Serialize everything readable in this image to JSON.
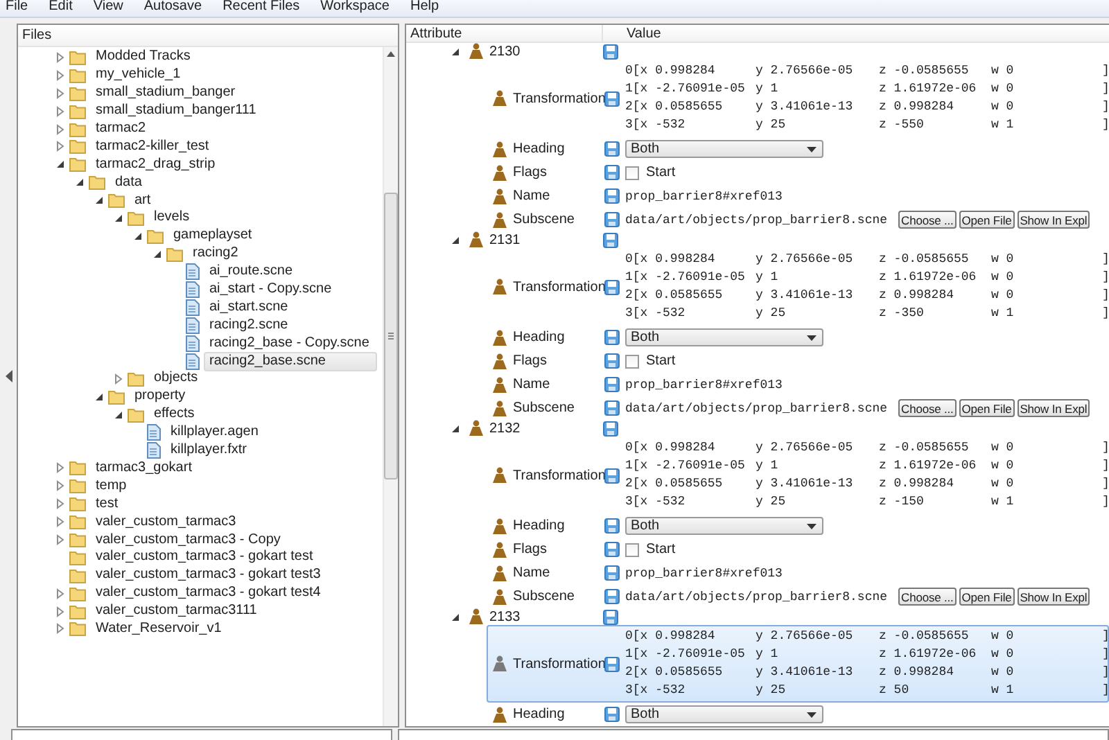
{
  "menu": [
    "File",
    "Edit",
    "View",
    "Autosave",
    "Recent Files",
    "Workspace",
    "Help"
  ],
  "files_panel": {
    "title": "Files",
    "tree": [
      {
        "name": "Modded Tracks",
        "kind": "folder",
        "expanded": false,
        "selected": false
      },
      {
        "name": "my_vehicle_1",
        "kind": "folder",
        "expanded": false,
        "selected": false
      },
      {
        "name": "small_stadium_banger",
        "kind": "folder",
        "expanded": false,
        "selected": false
      },
      {
        "name": "small_stadium_banger111",
        "kind": "folder",
        "expanded": false,
        "selected": false
      },
      {
        "name": "tarmac2",
        "kind": "folder",
        "expanded": false,
        "selected": false
      },
      {
        "name": "tarmac2-killer_test",
        "kind": "folder",
        "expanded": false,
        "selected": false
      },
      {
        "name": "tarmac2_drag_strip",
        "kind": "folder",
        "expanded": true,
        "selected": false,
        "children": [
          {
            "name": "data",
            "kind": "folder",
            "expanded": true,
            "selected": false,
            "children": [
              {
                "name": "art",
                "kind": "folder",
                "expanded": true,
                "selected": false,
                "children": [
                  {
                    "name": "levels",
                    "kind": "folder",
                    "expanded": true,
                    "selected": false,
                    "children": [
                      {
                        "name": "gameplayset",
                        "kind": "folder",
                        "expanded": true,
                        "selected": false,
                        "children": [
                          {
                            "name": "racing2",
                            "kind": "folder",
                            "expanded": true,
                            "selected": false,
                            "children": [
                              {
                                "name": "ai_route.scne",
                                "kind": "file",
                                "selected": false
                              },
                              {
                                "name": "ai_start - Copy.scne",
                                "kind": "file",
                                "selected": false
                              },
                              {
                                "name": "ai_start.scne",
                                "kind": "file",
                                "selected": false
                              },
                              {
                                "name": "racing2.scne",
                                "kind": "file",
                                "selected": false
                              },
                              {
                                "name": "racing2_base - Copy.scne",
                                "kind": "file",
                                "selected": false
                              },
                              {
                                "name": "racing2_base.scne",
                                "kind": "file",
                                "selected": true
                              }
                            ]
                          }
                        ]
                      }
                    ]
                  },
                  {
                    "name": "objects",
                    "kind": "folder",
                    "expanded": false,
                    "selected": false
                  }
                ]
              },
              {
                "name": "property",
                "kind": "folder",
                "expanded": true,
                "selected": false,
                "children": [
                  {
                    "name": "effects",
                    "kind": "folder",
                    "expanded": true,
                    "selected": false,
                    "children": [
                      {
                        "name": "killplayer.agen",
                        "kind": "file",
                        "selected": false
                      },
                      {
                        "name": "killplayer.fxtr",
                        "kind": "file",
                        "selected": false
                      }
                    ]
                  }
                ]
              }
            ]
          }
        ]
      },
      {
        "name": "tarmac3_gokart",
        "kind": "folder",
        "expanded": false,
        "selected": false
      },
      {
        "name": "temp",
        "kind": "folder",
        "expanded": false,
        "selected": false
      },
      {
        "name": "test",
        "kind": "folder",
        "expanded": false,
        "selected": false
      },
      {
        "name": "valer_custom_tarmac3",
        "kind": "folder",
        "expanded": false,
        "selected": false
      },
      {
        "name": "valer_custom_tarmac3 - Copy",
        "kind": "folder",
        "expanded": false,
        "selected": false
      },
      {
        "name": "valer_custom_tarmac3 - gokart test",
        "kind": "folder",
        "selected": false
      },
      {
        "name": "valer_custom_tarmac3 - gokart test3",
        "kind": "folder",
        "selected": false
      },
      {
        "name": "valer_custom_tarmac3 - gokart test4",
        "kind": "folder",
        "expanded": false,
        "selected": false
      },
      {
        "name": "valer_custom_tarmac3111",
        "kind": "folder",
        "expanded": false,
        "selected": false
      },
      {
        "name": "Water_Reservoir_v1",
        "kind": "folder",
        "expanded": false,
        "selected": false
      }
    ]
  },
  "attributes": {
    "columns": [
      "Attribute",
      "Value"
    ],
    "groups": [
      {
        "id": "2130",
        "expanded": true,
        "rows": [
          {
            "kind": "matrix",
            "label": "Transformation",
            "selected": false,
            "lines": [
              [
                "0[x 0.998284",
                "y 2.76566e-05",
                "z -0.0585655",
                "w 0",
                "]"
              ],
              [
                "1[x -2.76091e-05",
                "y 1",
                "z 1.61972e-06",
                "w 0",
                "]"
              ],
              [
                "2[x 0.0585655",
                "y 3.41061e-13",
                "z 0.998284",
                "w 0",
                "]"
              ],
              [
                "3[x -532",
                "y 25",
                "z -550",
                "w 1",
                "]"
              ]
            ]
          },
          {
            "kind": "dropdown",
            "label": "Heading",
            "selected": false,
            "value": "Both"
          },
          {
            "kind": "checkbox",
            "label": "Flags",
            "selected": false,
            "option": "Start",
            "checked": false
          },
          {
            "kind": "text",
            "label": "Name",
            "selected": false,
            "value": "prop_barrier8#xref013"
          },
          {
            "kind": "file",
            "label": "Subscene",
            "selected": false,
            "value": "data/art/objects/prop_barrier8.scne",
            "buttons": [
              "Choose ...",
              "Open File",
              "Show In Expl"
            ]
          }
        ]
      },
      {
        "id": "2131",
        "expanded": true,
        "rows": [
          {
            "kind": "matrix",
            "label": "Transformation",
            "selected": false,
            "lines": [
              [
                "0[x 0.998284",
                "y 2.76566e-05",
                "z -0.0585655",
                "w 0",
                "]"
              ],
              [
                "1[x -2.76091e-05",
                "y 1",
                "z 1.61972e-06",
                "w 0",
                "]"
              ],
              [
                "2[x 0.0585655",
                "y 3.41061e-13",
                "z 0.998284",
                "w 0",
                "]"
              ],
              [
                "3[x -532",
                "y 25",
                "z -350",
                "w 1",
                "]"
              ]
            ]
          },
          {
            "kind": "dropdown",
            "label": "Heading",
            "selected": false,
            "value": "Both"
          },
          {
            "kind": "checkbox",
            "label": "Flags",
            "selected": false,
            "option": "Start",
            "checked": false
          },
          {
            "kind": "text",
            "label": "Name",
            "selected": false,
            "value": "prop_barrier8#xref013"
          },
          {
            "kind": "file",
            "label": "Subscene",
            "selected": false,
            "value": "data/art/objects/prop_barrier8.scne",
            "buttons": [
              "Choose ...",
              "Open File",
              "Show In Expl"
            ]
          }
        ]
      },
      {
        "id": "2132",
        "expanded": true,
        "rows": [
          {
            "kind": "matrix",
            "label": "Transformation",
            "selected": false,
            "lines": [
              [
                "0[x 0.998284",
                "y 2.76566e-05",
                "z -0.0585655",
                "w 0",
                "]"
              ],
              [
                "1[x -2.76091e-05",
                "y 1",
                "z 1.61972e-06",
                "w 0",
                "]"
              ],
              [
                "2[x 0.0585655",
                "y 3.41061e-13",
                "z 0.998284",
                "w 0",
                "]"
              ],
              [
                "3[x -532",
                "y 25",
                "z -150",
                "w 1",
                "]"
              ]
            ]
          },
          {
            "kind": "dropdown",
            "label": "Heading",
            "selected": false,
            "value": "Both"
          },
          {
            "kind": "checkbox",
            "label": "Flags",
            "selected": false,
            "option": "Start",
            "checked": false
          },
          {
            "kind": "text",
            "label": "Name",
            "selected": false,
            "value": "prop_barrier8#xref013"
          },
          {
            "kind": "file",
            "label": "Subscene",
            "selected": false,
            "value": "data/art/objects/prop_barrier8.scne",
            "buttons": [
              "Choose ...",
              "Open File",
              "Show In Expl"
            ]
          }
        ]
      },
      {
        "id": "2133",
        "expanded": true,
        "rows": [
          {
            "kind": "matrix",
            "label": "Transformation",
            "selected": true,
            "lines": [
              [
                "0[x 0.998284",
                "y 2.76566e-05",
                "z -0.0585655",
                "w 0",
                "]"
              ],
              [
                "1[x -2.76091e-05",
                "y 1",
                "z 1.61972e-06",
                "w 0",
                "]"
              ],
              [
                "2[x 0.0585655",
                "y 3.41061e-13",
                "z 0.998284",
                "w 0",
                "]"
              ],
              [
                "3[x -532",
                "y 25",
                "z 50",
                "w 1",
                "]"
              ]
            ]
          },
          {
            "kind": "dropdown",
            "label": "Heading",
            "selected": false,
            "value": "Both"
          }
        ]
      }
    ]
  }
}
